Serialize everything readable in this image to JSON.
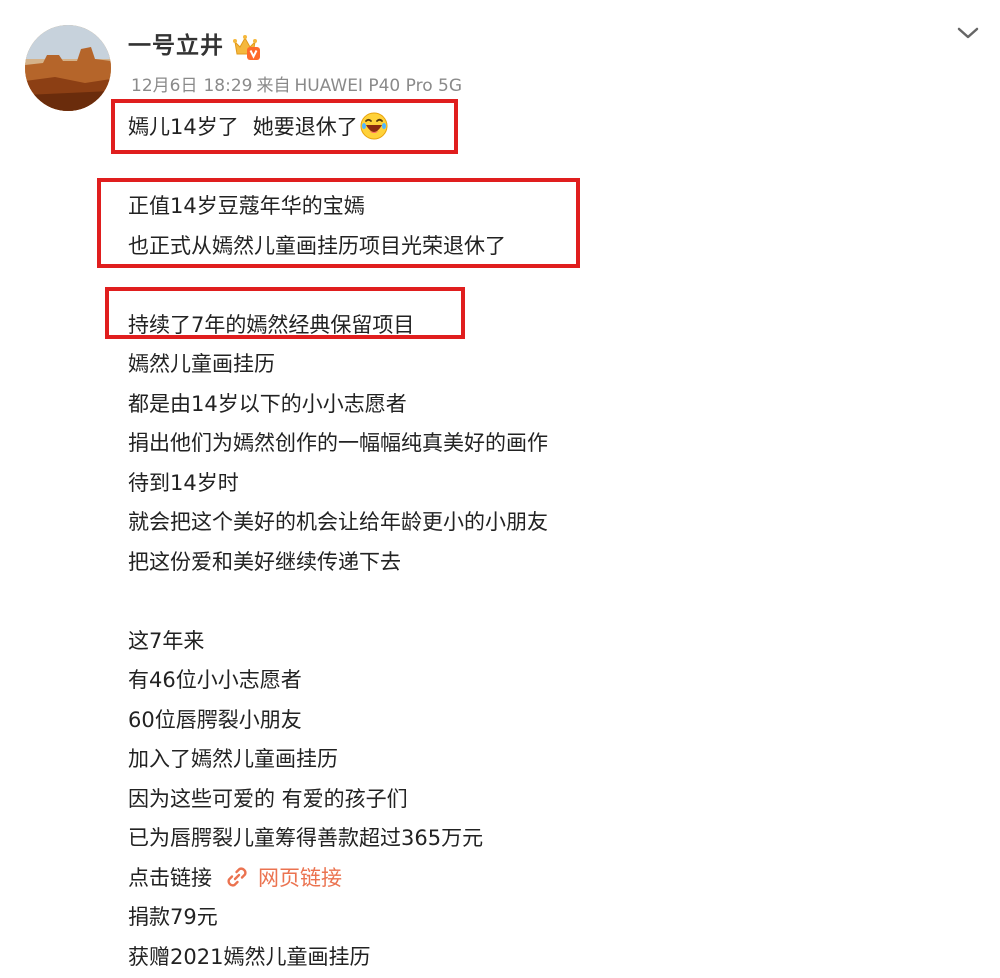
{
  "post": {
    "author": "一号立井",
    "date": "12月6日",
    "time": "18:29",
    "source_prefix": "来自",
    "device": "HUAWEI P40 Pro 5G"
  },
  "icons": {
    "avatar": "desert-mesa-avatar",
    "badge": "vip-crown-badge-icon",
    "menu": "chevron-down-icon",
    "emoji": "laughing-crying-emoji-icon",
    "link": "link-icon"
  },
  "colors": {
    "highlight_box": "#e01e1e",
    "link": "#eb7350",
    "meta_text": "#8a8a8a"
  },
  "body": {
    "line1_a": "嫣儿14岁了",
    "line1_b": "她要退休了",
    "line2": "正值14岁豆蔻年华的宝嫣",
    "line3": "也正式从嫣然儿童画挂历项目光荣退休了",
    "line4": "持续了7年的嫣然经典保留项目",
    "line5": "嫣然儿童画挂历",
    "line6": "都是由14岁以下的小小志愿者",
    "line7": "捐出他们为嫣然创作的一幅幅纯真美好的画作",
    "line8": "待到14岁时",
    "line9": "就会把这个美好的机会让给年龄更小的小朋友",
    "line10": "把这份爱和美好继续传递下去",
    "line11": "这7年来",
    "line12": "有46位小小志愿者",
    "line13": "60位唇腭裂小朋友",
    "line14": "加入了嫣然儿童画挂历",
    "line15": "因为这些可爱的 有爱的孩子们",
    "line16": "已为唇腭裂儿童筹得善款超过365万元",
    "line17": "点击链接",
    "link_text": "网页链接",
    "line18": "捐款79元",
    "line19": "获赠2021嫣然儿童画挂历"
  }
}
